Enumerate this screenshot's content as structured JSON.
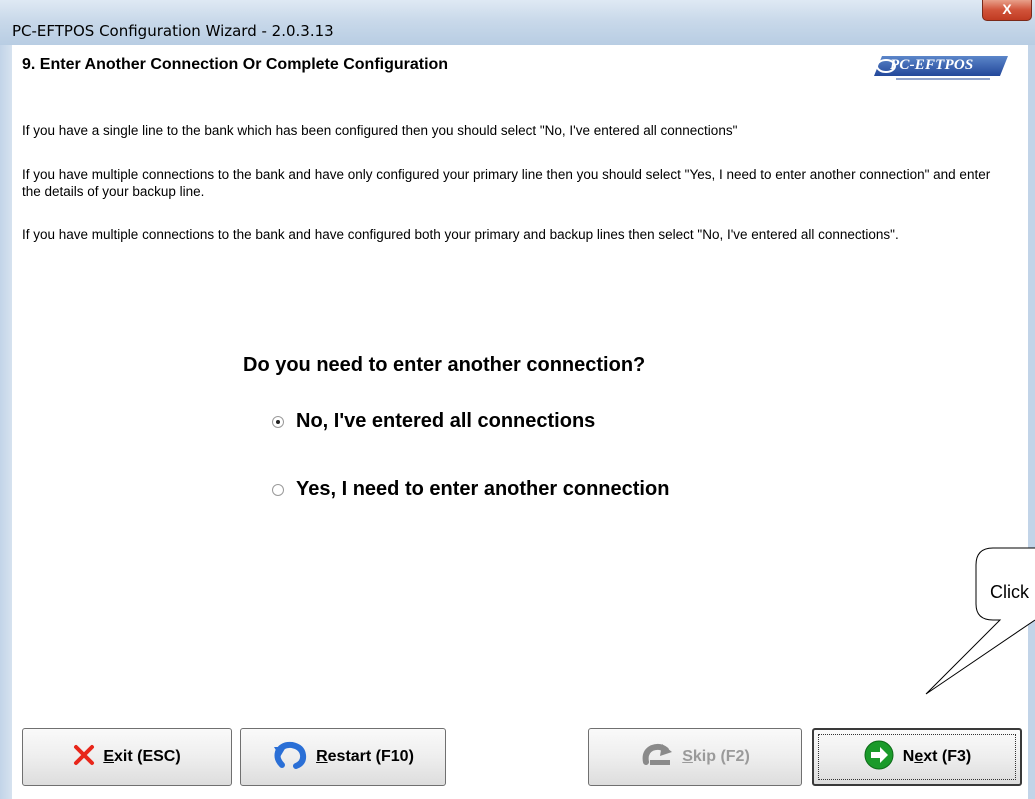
{
  "window": {
    "title": "PC-EFTPOS Configuration Wizard - 2.0.3.13",
    "close_label": "X"
  },
  "step": {
    "title": "9. Enter Another Connection Or Complete Configuration",
    "logo_text": "PC-EFTPOS"
  },
  "instructions": {
    "p1": "If you have a single line to the bank which has been configured then you should select \"No, I've entered all connections\"",
    "p2": "If you have multiple connections to the bank and have only configured your primary line then you should select \"Yes, I need to enter another connection\" and enter the details of your backup line.",
    "p3": "If you have multiple connections to the bank and have configured both your primary and backup lines then select \"No, I've entered all connections\"."
  },
  "question": {
    "text": "Do you need to enter another connection?",
    "options": [
      {
        "label": "No, I've entered all connections",
        "selected": true
      },
      {
        "label": "Yes, I need to enter another connection",
        "selected": false
      }
    ]
  },
  "callout": {
    "text": "Click"
  },
  "buttons": {
    "exit": {
      "mnemonic": "E",
      "rest": "xit (ESC)",
      "icon": "x-icon",
      "color": "#e8261a"
    },
    "restart": {
      "mnemonic": "R",
      "rest": "estart (F10)",
      "icon": "restart-arrow-icon",
      "color": "#2a6fd6"
    },
    "skip": {
      "mnemonic": "S",
      "rest": "kip (F2)",
      "icon": "skip-arrow-icon",
      "enabled": false
    },
    "next": {
      "prefix": "N",
      "mnemonic": "e",
      "rest": "xt (F3)",
      "icon": "next-arrow-icon",
      "color": "#1a9a2a"
    }
  }
}
